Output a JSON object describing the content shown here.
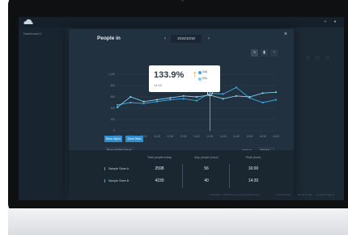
{
  "app": {
    "sidebar_item": "Dashboard 1",
    "topbar_icons": [
      "plus-icon",
      "user-icon"
    ]
  },
  "modal": {
    "title": "People in",
    "date": "2016/10/18",
    "prev_icon": "chevron-left-icon",
    "next_icon": "chevron-right-icon",
    "close_icon": "close-icon",
    "tools": [
      "line-chart-icon",
      "bar-chart-icon",
      "pie-chart-icon"
    ]
  },
  "tooltip": {
    "value": "133.9%",
    "trend_icon": "arrow-up-icon",
    "sub": "14:03",
    "legend": [
      "104",
      "231"
    ]
  },
  "chart_data": {
    "type": "line",
    "x": [
      "10:00",
      "10:30",
      "11:00",
      "11:30",
      "12:00",
      "12:30",
      "13:00",
      "13:30",
      "14:00",
      "14:30",
      "15:00",
      "15:30",
      "16:00"
    ],
    "series": [
      {
        "values": [
          55,
          60,
          58,
          62,
          66,
          68,
          64,
          80,
          78,
          92,
          70,
          60,
          66
        ]
      },
      {
        "values": [
          50,
          72,
          62,
          66,
          70,
          74,
          72,
          76,
          68,
          74,
          72,
          80,
          82
        ]
      }
    ],
    "ylim": [
      0,
      120
    ],
    "yticks": [
      "1,000",
      "800",
      "600",
      "400",
      "200",
      "0"
    ],
    "colors": [
      "#3fa7e0",
      "#7fd0f0"
    ]
  },
  "controls": {
    "segments": [
      "Store Alpha",
      "Store Beta"
    ],
    "left_dropdown": "Store All Per Day",
    "interval_label": "Interval",
    "interval_value": "Hour"
  },
  "summary": {
    "columns": [
      "Total people in/day",
      "Avg. people (hour)",
      "Peak (hour)"
    ],
    "rows": [
      {
        "label": "Sample Store A",
        "values": [
          "2598",
          "56",
          "16:00"
        ]
      },
      {
        "label": "Sample Store B",
        "values": [
          "4230",
          "40",
          "14:30"
        ]
      }
    ]
  },
  "footer": [
    "Copyright © 2016 People Counting Dashboard",
    "Privacy Policy",
    "Terms of Use",
    "Contact Support"
  ]
}
